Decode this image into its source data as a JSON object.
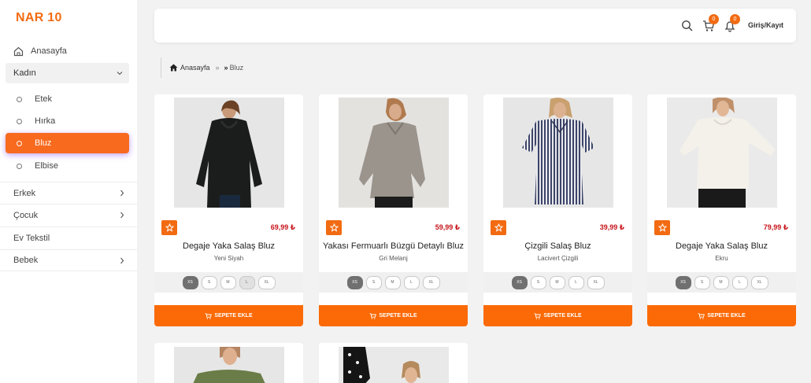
{
  "brand": "NAR 10",
  "sidebar": {
    "home": "Anasayfa",
    "open_category": "Kadın",
    "sub_items": [
      {
        "label": "Etek"
      },
      {
        "label": "Hırka"
      },
      {
        "label": "Bluz"
      },
      {
        "label": "Elbise"
      }
    ],
    "categories": [
      {
        "label": "Erkek",
        "chevron": "chevron-right-icon"
      },
      {
        "label": "Çocuk",
        "chevron": "chevron-right-icon"
      },
      {
        "label": "Ev Tekstil",
        "chevron": ""
      },
      {
        "label": "Bebek",
        "chevron": "chevron-right-icon"
      }
    ]
  },
  "header": {
    "cart_count": "0",
    "notification_count": "0",
    "login": "Giriş/Kayıt"
  },
  "breadcrumb": {
    "home": "Anasayfa",
    "current": "Bluz"
  },
  "products": [
    {
      "name": "Degaje Yaka Salaş Bluz",
      "color": "Yeni Siyah",
      "price": "69,99 ₺",
      "cart_label": "SEPETE EKLE"
    },
    {
      "name": "Yakası Fermuarlı Büzgü Detaylı Bluz",
      "color": "Gri Melanj",
      "price": "59,99 ₺",
      "cart_label": "SEPETE EKLE"
    },
    {
      "name": "Çizgili Salaş Bluz",
      "color": "Lacivert Çizgili",
      "price": "39,99 ₺",
      "cart_label": "SEPETE EKLE"
    },
    {
      "name": "Degaje Yaka Salaş Bluz",
      "color": "Ekru",
      "price": "79,99 ₺",
      "cart_label": "SEPETE EKLE"
    }
  ],
  "sizes": [
    "XS",
    "S",
    "M",
    "L",
    "XL"
  ],
  "colors": {
    "accent": "#f26b12",
    "button": "#fb6a06",
    "price": "#c6141b",
    "active_glow": "#8c50f0"
  }
}
